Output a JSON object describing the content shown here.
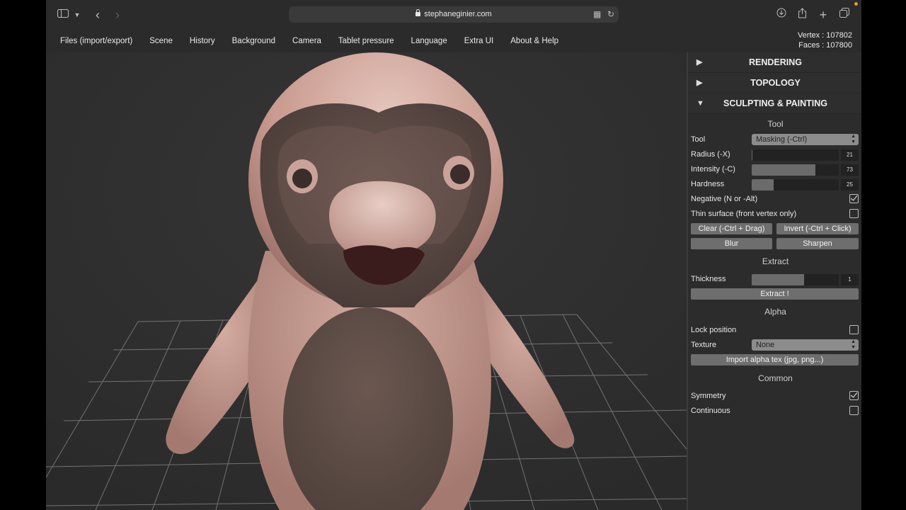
{
  "browser": {
    "url": "stephaneginier.com"
  },
  "menu": {
    "items": [
      "Files (import/export)",
      "Scene",
      "History",
      "Background",
      "Camera",
      "Tablet pressure",
      "Language",
      "Extra UI",
      "About & Help"
    ]
  },
  "stats": {
    "vertex": "Vertex : 107802",
    "faces": "Faces : 107800"
  },
  "panel": {
    "sections": {
      "rendering": "RENDERING",
      "topology": "TOPOLOGY",
      "sculpting": "SCULPTING & PAINTING"
    },
    "tool_group": {
      "title": "Tool",
      "tool_label": "Tool",
      "tool_value": "Masking (-Ctrl)",
      "radius_label": "Radius (-X)",
      "radius_value": "21",
      "radius_level": 0.01,
      "intensity_label": "Intensity (-C)",
      "intensity_value": "73",
      "intensity_level": 0.73,
      "hardness_label": "Hardness",
      "hardness_value": "25",
      "hardness_level": 0.25,
      "negative_label": "Negative (N or -Alt)",
      "negative_checked": true,
      "thin_label": "Thin surface (front vertex only)",
      "thin_checked": false,
      "clear_button": "Clear (-Ctrl + Drag)",
      "invert_button": "Invert (-Ctrl + Click)",
      "blur_button": "Blur",
      "sharpen_button": "Sharpen"
    },
    "extract_group": {
      "title": "Extract",
      "thickness_label": "Thickness",
      "thickness_value": "1",
      "thickness_level": 0.6,
      "extract_button": "Extract !"
    },
    "alpha_group": {
      "title": "Alpha",
      "lock_label": "Lock position",
      "lock_checked": false,
      "texture_label": "Texture",
      "texture_value": "None",
      "import_button": "Import alpha tex (jpg, png...)"
    },
    "common_group": {
      "title": "Common",
      "symmetry_label": "Symmetry",
      "symmetry_checked": true,
      "continuous_label": "Continuous",
      "continuous_checked": false
    }
  },
  "colors": {
    "accent_dot": "#e9963b",
    "model_skin": "#c99a8f",
    "model_mask": "#5a4a45"
  }
}
